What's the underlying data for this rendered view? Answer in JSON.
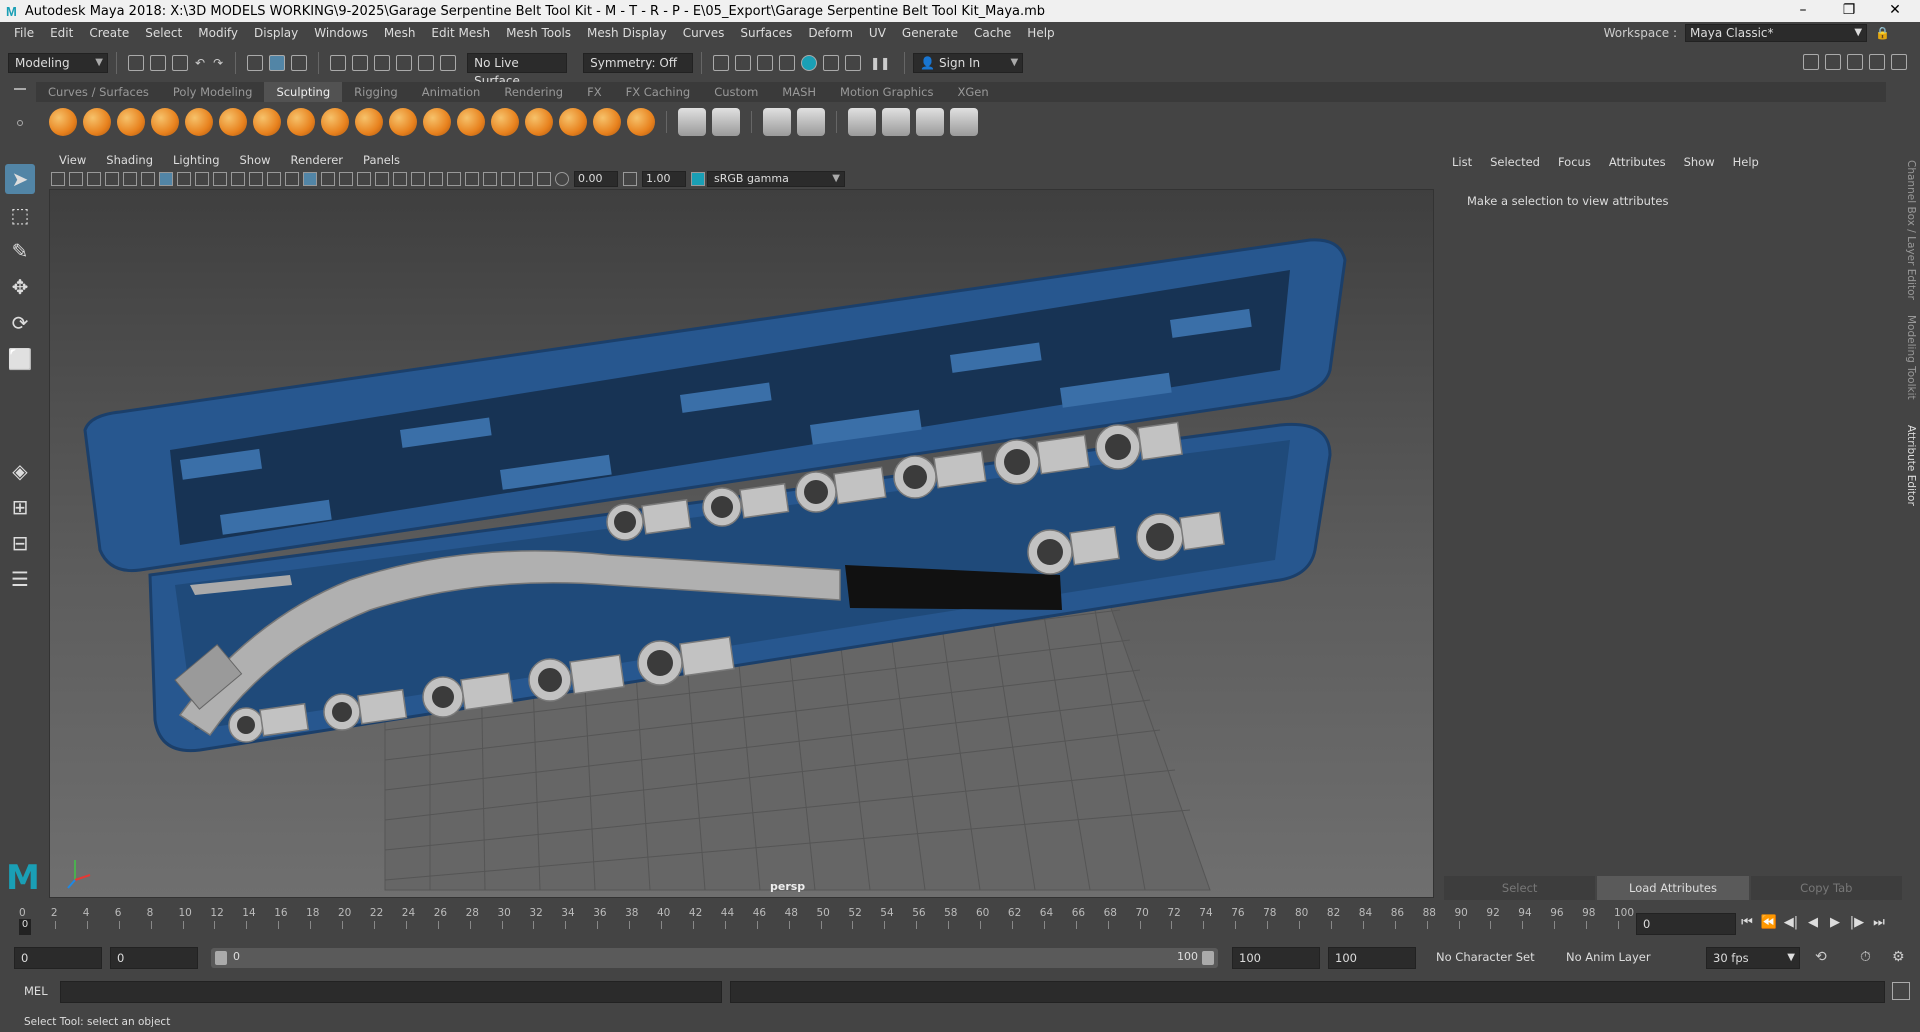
{
  "window": {
    "title": "Autodesk Maya 2018: X:\\3D MODELS WORKING\\9-2025\\Garage Serpentine Belt Tool Kit - M - T - R - P - E\\05_Export\\Garage Serpentine Belt Tool Kit_Maya.mb",
    "logo": "M"
  },
  "menu": [
    "File",
    "Edit",
    "Create",
    "Select",
    "Modify",
    "Display",
    "Windows",
    "Mesh",
    "Edit Mesh",
    "Mesh Tools",
    "Mesh Display",
    "Curves",
    "Surfaces",
    "Deform",
    "UV",
    "Generate",
    "Cache",
    "Help"
  ],
  "workspace": {
    "label": "Workspace :",
    "value": "Maya Classic*"
  },
  "statusline": {
    "mode": "Modeling",
    "live_surface": "No Live Surface",
    "symmetry": "Symmetry: Off",
    "sign_in": "Sign In"
  },
  "shelf_tabs": [
    "Curves / Surfaces",
    "Poly Modeling",
    "Sculpting",
    "Rigging",
    "Animation",
    "Rendering",
    "FX",
    "FX Caching",
    "Custom",
    "MASH",
    "Motion Graphics",
    "XGen"
  ],
  "active_shelf_tab": "Sculpting",
  "viewport": {
    "menu": [
      "View",
      "Shading",
      "Lighting",
      "Show",
      "Renderer",
      "Panels"
    ],
    "exposure": "0.00",
    "gamma": "1.00",
    "color_space": "sRGB gamma",
    "camera": "persp"
  },
  "attribute_editor": {
    "menu": [
      "List",
      "Selected",
      "Focus",
      "Attributes",
      "Show",
      "Help"
    ],
    "message": "Make a selection to view attributes",
    "buttons": [
      "Select",
      "Load Attributes",
      "Copy Tab"
    ]
  },
  "side_tabs": [
    "Channel Box / Layer Editor",
    "Modeling Toolkit",
    "Attribute Editor"
  ],
  "timeline": {
    "ticks": [
      "0",
      "2",
      "4",
      "6",
      "8",
      "10",
      "12",
      "14",
      "16",
      "18",
      "20",
      "22",
      "24",
      "26",
      "28",
      "30",
      "32",
      "34",
      "36",
      "38",
      "40",
      "42",
      "44",
      "46",
      "48",
      "50",
      "52",
      "54",
      "56",
      "58",
      "60",
      "62",
      "64",
      "66",
      "68",
      "70",
      "72",
      "74",
      "76",
      "78",
      "80",
      "82",
      "84",
      "86",
      "88",
      "90",
      "92",
      "94",
      "96",
      "98",
      "100"
    ],
    "current_frame": "0",
    "marker": "0"
  },
  "range": {
    "start": "0",
    "anim_start": "0",
    "slider_start": "0",
    "slider_end": "100",
    "anim_end": "100",
    "end": "100",
    "character_set": "No Character Set",
    "anim_layer": "No Anim Layer",
    "fps": "30 fps"
  },
  "command": {
    "label": "MEL"
  },
  "status": {
    "help": "Select Tool: select an object"
  },
  "colors": {
    "case_blue": "#27578f",
    "maya_teal": "#1a9fb5",
    "accent_select": "#5285a6"
  }
}
